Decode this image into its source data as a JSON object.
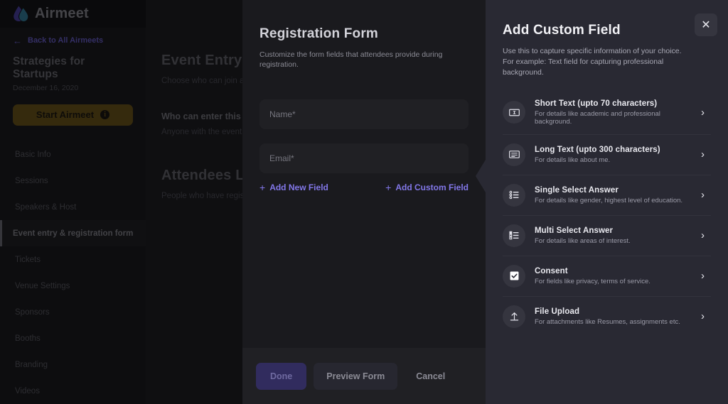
{
  "brand": {
    "name": "Airmeet",
    "logo_icon": "airmeet-droplet-logo"
  },
  "sidebar": {
    "back_link": {
      "label": "Back to All Airmeets",
      "icon": "arrow-left-icon"
    },
    "event_title": "Strategies for Startups",
    "event_date": "December 16, 2020",
    "start_button": {
      "label": "Start Airmeet",
      "icon": "info-icon",
      "color": "#6d5413"
    },
    "items": [
      {
        "label": "Basic Info",
        "active": false
      },
      {
        "label": "Sessions",
        "active": false
      },
      {
        "label": "Speakers & Host",
        "active": false
      },
      {
        "label": "Event entry & registration form",
        "active": true
      },
      {
        "label": "Tickets",
        "active": false
      },
      {
        "label": "Venue Settings",
        "active": false
      },
      {
        "label": "Sponsors",
        "active": false
      },
      {
        "label": "Booths",
        "active": false
      },
      {
        "label": "Branding",
        "active": false
      },
      {
        "label": "Videos",
        "active": false
      }
    ]
  },
  "main": {
    "heading": "Event Entry & Registration",
    "subheading": "Choose who can join and how they register",
    "section_heading": "Who can enter this event?",
    "section_sub": "Anyone with the event link",
    "attendees_heading": "Attendees List",
    "attendees_sub": "People who have registered for this event"
  },
  "form_panel": {
    "title": "Registration Form",
    "subtitle": "Customize the form fields that attendees provide during registration.",
    "fields": [
      {
        "label": "Name*"
      },
      {
        "label": "Email*"
      }
    ],
    "add_new_field": "Add New Field",
    "add_custom_field": "Add Custom Field",
    "plus_icon": "plus-icon",
    "accent_color": "#8277e8",
    "footer": {
      "done": "Done",
      "preview": "Preview Form",
      "cancel": "Cancel",
      "done_color": "#312c5e"
    }
  },
  "custom_panel": {
    "title": "Add Custom Field",
    "subtitle": "Use this to capture specific information of your choice. For example: Text field for capturing professional background.",
    "close_icon": "close-icon",
    "chevron_icon": "chevron-right-icon",
    "items": [
      {
        "title": "Short Text (upto 70 characters)",
        "desc": "For details like academic and professional background.",
        "icon": "short-text-icon"
      },
      {
        "title": "Long Text (upto 300 characters)",
        "desc": "For details like about me.",
        "icon": "long-text-icon"
      },
      {
        "title": "Single Select Answer",
        "desc": "For details like gender, highest level of education.",
        "icon": "single-select-icon"
      },
      {
        "title": "Multi Select Answer",
        "desc": "For details like areas of interest.",
        "icon": "multi-select-icon"
      },
      {
        "title": "Consent",
        "desc": "For fields like privacy, terms of service.",
        "icon": "checkbox-icon"
      },
      {
        "title": "File Upload",
        "desc": "For attachments like Resumes, assignments etc.",
        "icon": "upload-icon"
      }
    ]
  }
}
